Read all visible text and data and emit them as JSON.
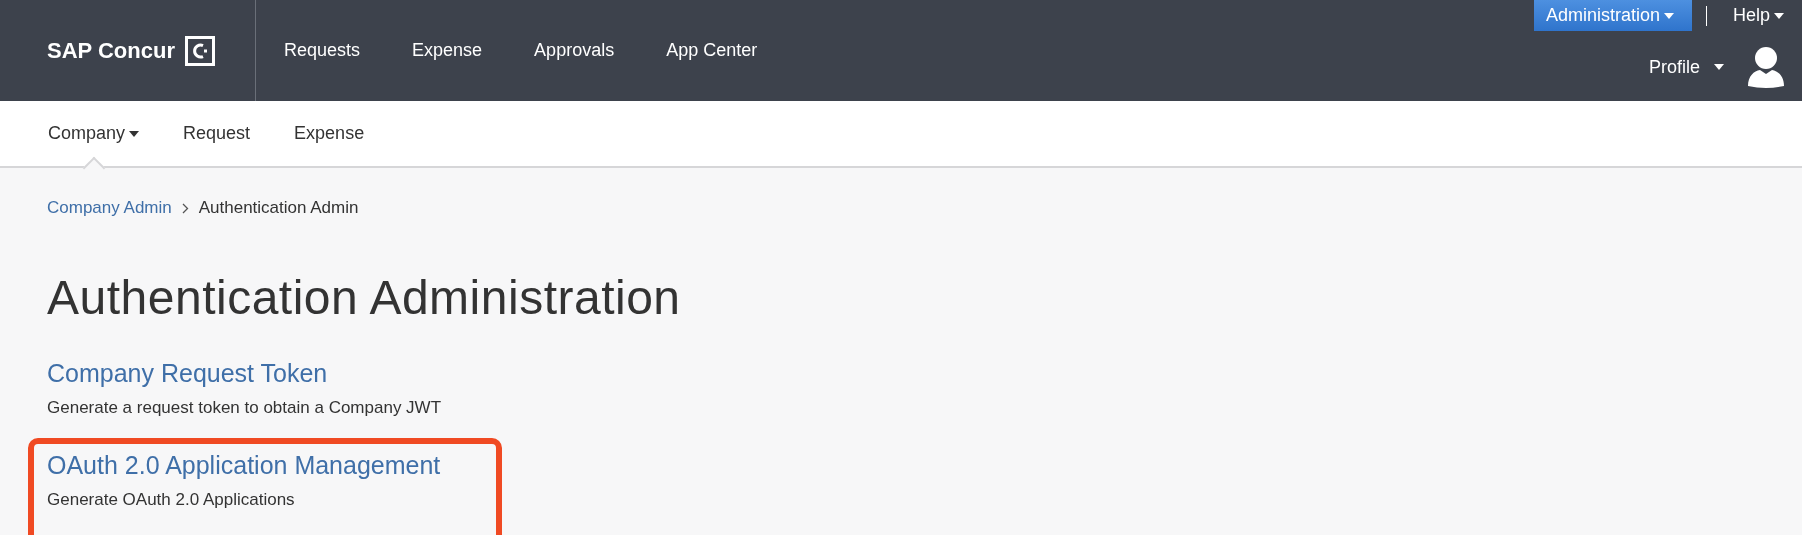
{
  "header": {
    "logo": "SAP Concur",
    "nav": [
      {
        "label": "Requests"
      },
      {
        "label": "Expense"
      },
      {
        "label": "Approvals"
      },
      {
        "label": "App Center"
      }
    ],
    "utility": [
      {
        "label": "Administration",
        "selected": true
      },
      {
        "label": "Help",
        "selected": false
      }
    ],
    "profile": "Profile"
  },
  "subnav": [
    {
      "label": "Company",
      "selected": true,
      "dropdown": true
    },
    {
      "label": "Request",
      "selected": false,
      "dropdown": false
    },
    {
      "label": "Expense",
      "selected": false,
      "dropdown": false
    }
  ],
  "breadcrumb": [
    {
      "label": "Company Admin",
      "kind": "link"
    },
    {
      "label": "Authentication Admin",
      "kind": "current"
    }
  ],
  "title": "Authentication Administration",
  "sections": [
    {
      "link": "Company Request Token",
      "description": "Generate a request token to obtain a Company JWT",
      "highlighted": false
    },
    {
      "link": "OAuth 2.0 Application Management",
      "description": "Generate OAuth 2.0 Applications",
      "highlighted": true
    }
  ]
}
